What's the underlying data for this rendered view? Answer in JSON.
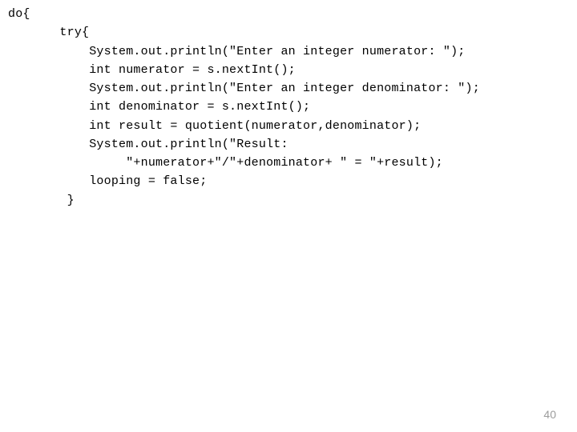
{
  "code": {
    "lines": [
      "do{",
      "       try{",
      "           System.out.println(\"Enter an integer numerator: \");",
      "           int numerator = s.nextInt();",
      "           System.out.println(\"Enter an integer denominator: \");",
      "           int denominator = s.nextInt();",
      "           int result = quotient(numerator,denominator);",
      "           System.out.println(\"Result:",
      "                \"+numerator+\"/\"+denominator+ \" = \"+result);",
      "           looping = false;",
      "        }"
    ]
  },
  "page_number": "40"
}
